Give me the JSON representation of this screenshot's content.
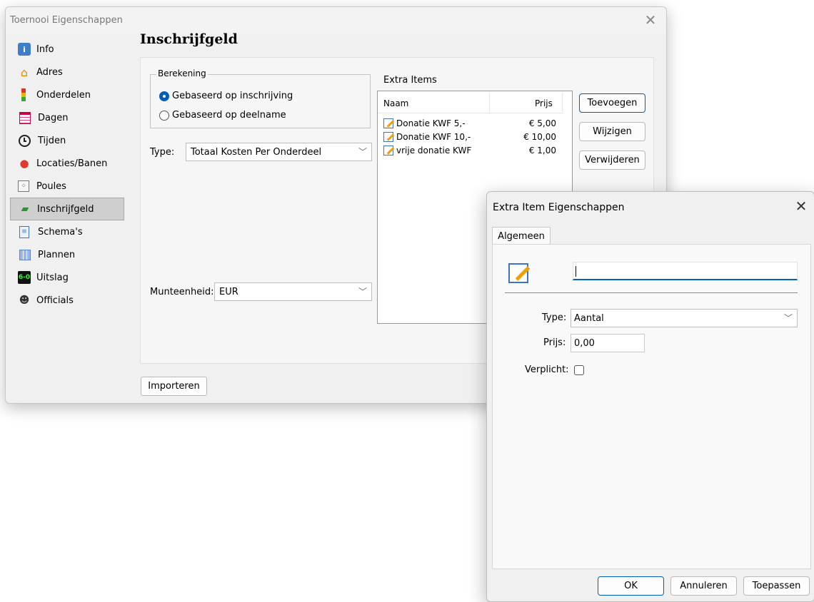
{
  "main_dialog": {
    "title": "Toernooi Eigenschappen",
    "close_glyph": "✕",
    "sidebar": [
      {
        "label": "Info",
        "icon": "info-icon"
      },
      {
        "label": "Adres",
        "icon": "house-icon"
      },
      {
        "label": "Onderdelen",
        "icon": "bars-icon"
      },
      {
        "label": "Dagen",
        "icon": "calendar-icon"
      },
      {
        "label": "Tijden",
        "icon": "clock-icon"
      },
      {
        "label": "Locaties/Banen",
        "icon": "location-pin-icon"
      },
      {
        "label": "Poules",
        "icon": "grid-icon"
      },
      {
        "label": "Inschrijfgeld",
        "icon": "money-icon",
        "selected": true
      },
      {
        "label": "Schema's",
        "icon": "document-icon"
      },
      {
        "label": "Plannen",
        "icon": "plan-icon"
      },
      {
        "label": "Uitslag",
        "icon": "scoreboard-icon"
      },
      {
        "label": "Officials",
        "icon": "official-icon"
      }
    ],
    "page_title": "Inschrijfgeld",
    "berekening": {
      "caption": "Berekening",
      "option1": "Gebaseerd op inschrijving",
      "option2": "Gebaseerd op deelname",
      "selected": "option1"
    },
    "type_label": "Type:",
    "type_value": "Totaal Kosten Per Onderdeel",
    "currency_label": "Munteenheid:",
    "currency_value": "EUR",
    "extra_items": {
      "caption": "Extra Items",
      "col_name": "Naam",
      "col_price": "Prijs",
      "rows": [
        {
          "name": "Donatie KWF 5,-",
          "price": "€ 5,00"
        },
        {
          "name": "Donatie KWF 10,-",
          "price": "€ 10,00"
        },
        {
          "name": "vrije donatie KWF",
          "price": "€ 1,00"
        }
      ]
    },
    "buttons": {
      "add": "Toevoegen",
      "edit": "Wijzigen",
      "remove": "Verwijderen",
      "import": "Importeren"
    }
  },
  "item_dialog": {
    "title": "Extra Item Eigenschappen",
    "close_glyph": "✕",
    "tab": "Algemeen",
    "name_value": "",
    "type_label": "Type:",
    "type_value": "Aantal",
    "price_label": "Prijs:",
    "price_value": "0,00",
    "required_label": "Verplicht:",
    "required_checked": false,
    "buttons": {
      "ok": "OK",
      "cancel": "Annuleren",
      "apply": "Toepassen"
    }
  },
  "colors": {
    "accent": "#005fb8",
    "selected_bg": "#cfcfcf"
  }
}
